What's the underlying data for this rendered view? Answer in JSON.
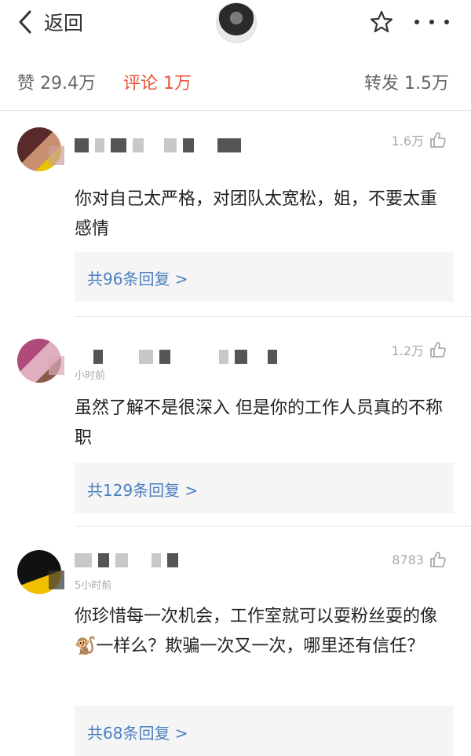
{
  "nav": {
    "back_label": "返回",
    "icons": [
      "back-chevron-icon",
      "avatar",
      "star-icon",
      "more-icon"
    ]
  },
  "tabs": [
    {
      "label": "赞 29.4万",
      "active": false
    },
    {
      "label": "评论 1万",
      "active": true
    },
    {
      "label": "转发 1.5万",
      "active": false
    }
  ],
  "comments": [
    {
      "time": "",
      "likes": "1.6万",
      "text": "你对自己太严格，对团队太宽松，姐，不要太重感情",
      "replies": "共96条回复 >"
    },
    {
      "time": "小时前",
      "likes": "1.2万",
      "text": "虽然了解不是很深入 但是你的工作人员真的不称职",
      "replies": "共129条回复 >"
    },
    {
      "time": "5小时前",
      "likes": "8783",
      "text": "你珍惜每一次机会，工作室就可以耍粉丝耍的像🐒一样么？欺骗一次又一次，哪里还有信任？",
      "replies": "共68条回复 >"
    }
  ],
  "colors": {
    "active_tab": "#e8553a",
    "reply_link": "#4a7fc1",
    "divider": "#e4e4e4"
  }
}
